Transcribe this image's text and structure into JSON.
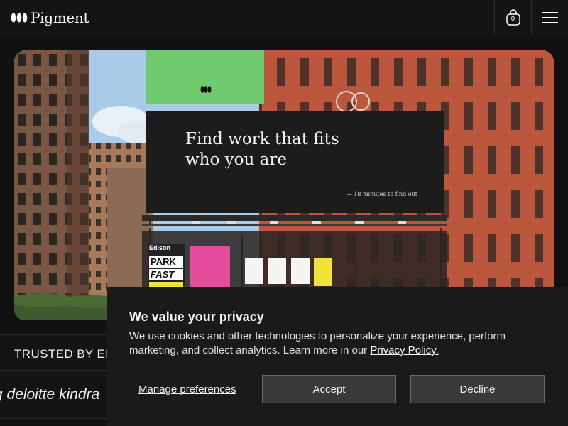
{
  "header": {
    "brand": "Pigment",
    "cart_count": "0",
    "icons": {
      "logo": "pigment-logo-mark",
      "cart": "shopping-bag-icon",
      "menu": "hamburger-menu-icon"
    }
  },
  "hero": {
    "billboard_headline": "Find work that fits who you are",
    "billboard_subtext": "→ 18 minutes to find out",
    "posters": [
      "Edison",
      "PARK",
      "FAST"
    ]
  },
  "trusted": {
    "label": "TRUSTED BY EM",
    "marquee": "g deloitte kindra"
  },
  "cookie": {
    "title": "We value your privacy",
    "body": "We use cookies and other technologies to personalize your experience, perform marketing, and collect analytics. Learn more in our ",
    "link": "Privacy Policy.",
    "manage": "Manage preferences",
    "accept": "Accept",
    "decline": "Decline"
  },
  "colors": {
    "background": "#111111",
    "banner": "#1a1a1a",
    "button": "#3a3a3a",
    "brick": "#b5533a",
    "billboard_green": "#6fc96f"
  }
}
